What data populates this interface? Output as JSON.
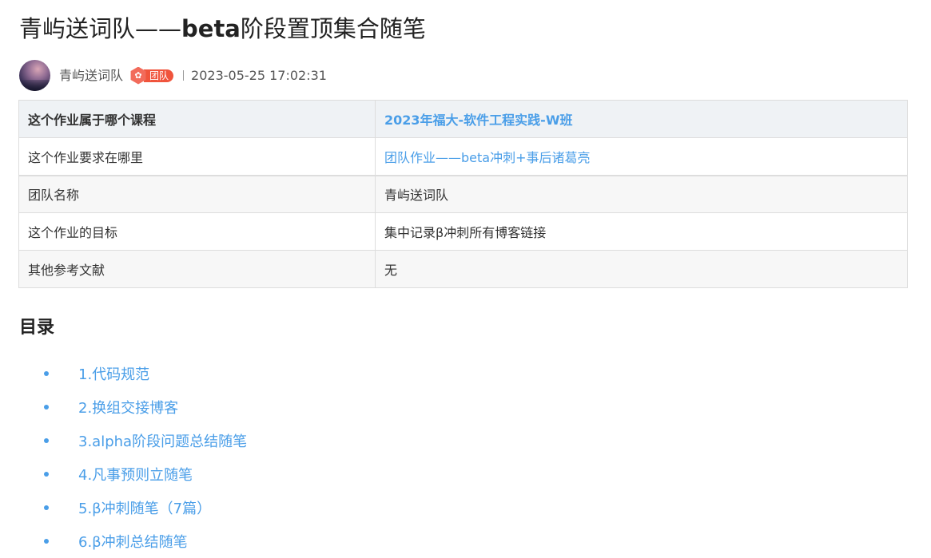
{
  "title": {
    "prefix": "青屿送词队——",
    "bold": "beta",
    "suffix": "阶段置顶集合随笔"
  },
  "author": {
    "name": "青屿送词队",
    "badge": "团队",
    "date": "2023-05-25 17:02:31"
  },
  "info_table": {
    "rows": [
      {
        "key": "这个作业属于哪个课程",
        "value": "2023年福大-软件工程实践-W班"
      },
      {
        "key": "这个作业要求在哪里",
        "value": "团队作业——beta冲刺+事后诸葛亮"
      },
      {
        "key": "团队名称",
        "value": "青屿送词队"
      },
      {
        "key": "这个作业的目标",
        "value": "集中记录β冲刺所有博客链接"
      },
      {
        "key": "其他参考文献",
        "value": "无"
      }
    ]
  },
  "toc": {
    "heading": "目录",
    "items": [
      "1.代码规范",
      "2.换组交接博客",
      "3.alpha阶段问题总结随笔",
      "4.凡事预则立随笔",
      "5.β冲刺随笔（7篇）",
      "6.β冲刺总结随笔"
    ]
  },
  "colors": {
    "link": "#4a9ee8",
    "badge": "#f0543c",
    "table_header_bg": "#eff2f5"
  }
}
